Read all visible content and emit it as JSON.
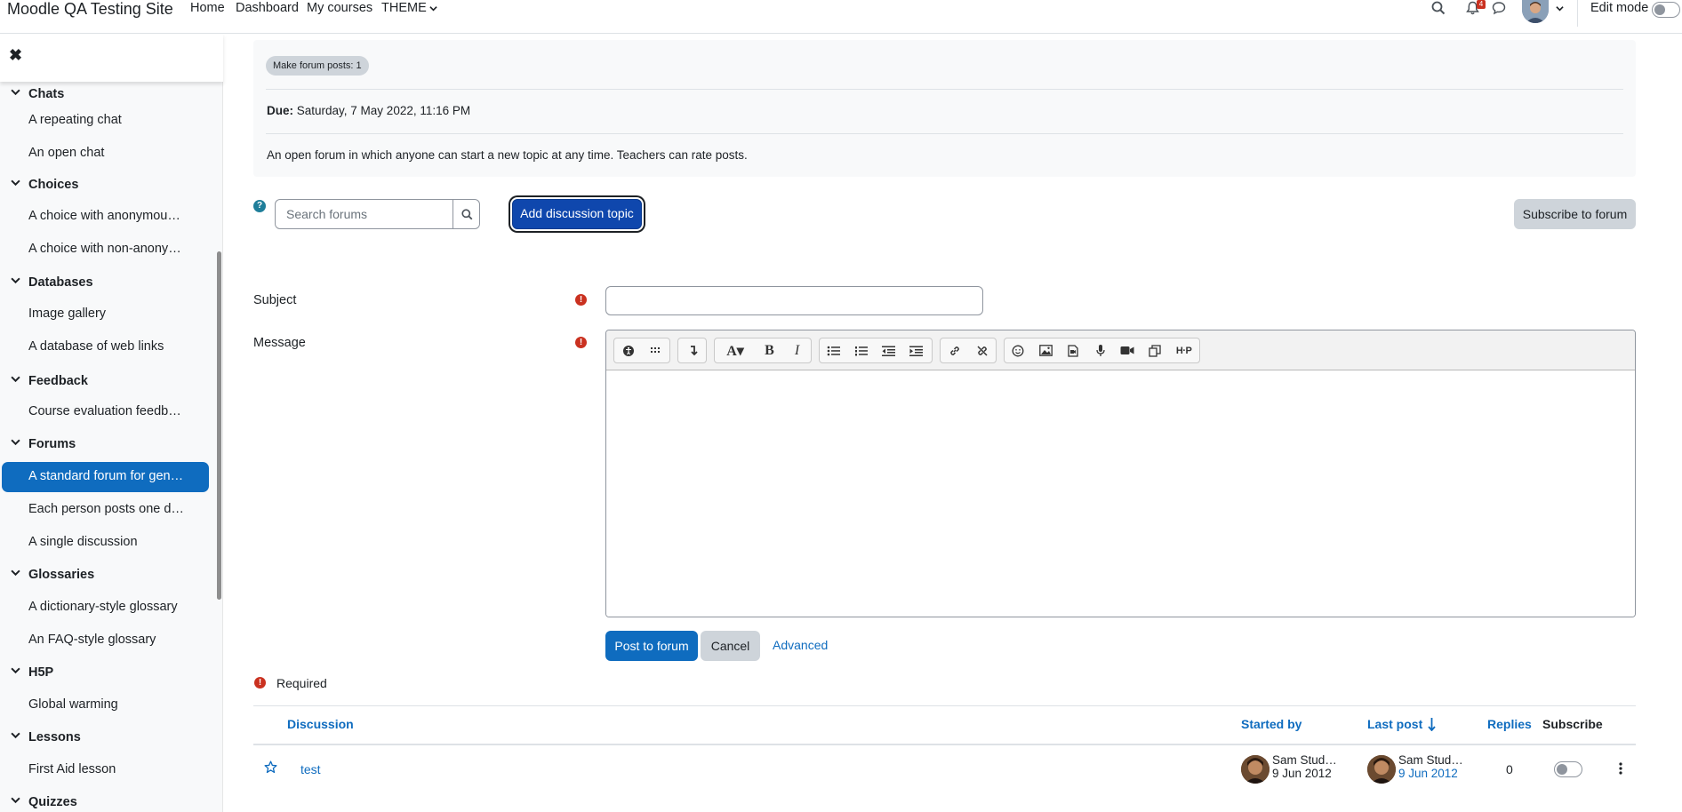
{
  "navbar": {
    "site_name": "Moodle QA Testing Site",
    "links": [
      "Home",
      "Dashboard",
      "My courses",
      "THEME"
    ],
    "notification_count": "4",
    "edit_mode_label": "Edit mode"
  },
  "drawer": {
    "sections": [
      {
        "label": "Chats",
        "items": [
          "A repeating chat",
          "An open chat"
        ]
      },
      {
        "label": "Choices",
        "items": [
          "A choice with anonymous …",
          "A choice with non-anonym…"
        ]
      },
      {
        "label": "Databases",
        "items": [
          "Image gallery",
          "A database of web links"
        ]
      },
      {
        "label": "Feedback",
        "items": [
          "Course evaluation feedback"
        ]
      },
      {
        "label": "Forums",
        "items": [
          "A standard forum for gene…",
          "Each person posts one dis…",
          "A single discussion"
        ]
      },
      {
        "label": "Glossaries",
        "items": [
          "A dictionary-style glossary",
          "An FAQ-style glossary"
        ]
      },
      {
        "label": "H5P",
        "items": [
          "Global warming"
        ]
      },
      {
        "label": "Lessons",
        "items": [
          "First Aid lesson"
        ]
      },
      {
        "label": "Quizzes",
        "items": []
      }
    ],
    "active_item": "A standard forum for gene…"
  },
  "intro": {
    "completion_pill": "Make forum posts: 1",
    "due_label": "Due:",
    "due_value": "Saturday, 7 May 2022, 11:16 PM",
    "description": "An open forum in which anyone can start a new topic at any time. Teachers can rate posts."
  },
  "actions": {
    "search_placeholder": "Search forums",
    "add_discussion": "Add discussion topic",
    "subscribe": "Subscribe to forum"
  },
  "form": {
    "subject_label": "Subject",
    "message_label": "Message",
    "post_button": "Post to forum",
    "cancel_button": "Cancel",
    "advanced_link": "Advanced",
    "required_note": "Required"
  },
  "table": {
    "headers": {
      "discussion": "Discussion",
      "started_by": "Started by",
      "last_post": "Last post",
      "replies": "Replies",
      "subscribe": "Subscribe"
    },
    "rows": [
      {
        "topic": "test",
        "starter_name": "Sam Stud…",
        "starter_date": "9 Jun 2012",
        "last_name": "Sam Stud…",
        "last_date": "9 Jun 2012",
        "replies": "0",
        "subscribed": false
      }
    ]
  },
  "colors": {
    "primary": "#0f6cbf",
    "focus_button": "#0f47ad",
    "danger": "#ca3120",
    "secondary_button": "#ced4da"
  }
}
